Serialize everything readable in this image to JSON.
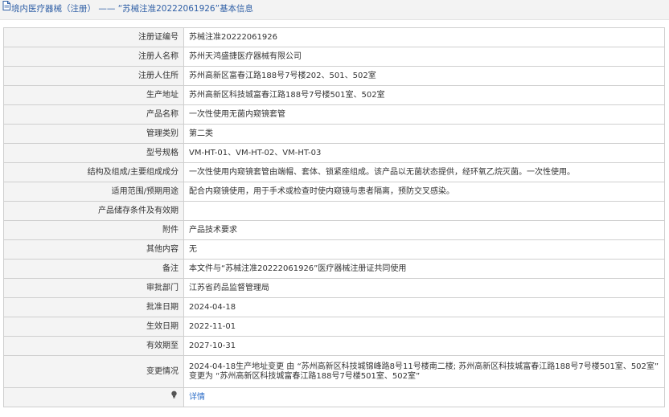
{
  "header": {
    "prefix": "境内医疗器械（注册）",
    "separator": " —— ",
    "quoted_name": "“苏械注准20222061926”",
    "suffix": "基本信息"
  },
  "rows": [
    {
      "label": "注册证编号",
      "value": "苏械注准20222061926"
    },
    {
      "label": "注册人名称",
      "value": "苏州天鸿盛捷医疗器械有限公司"
    },
    {
      "label": "注册人住所",
      "value": "苏州高新区富春江路188号7号楼202、501、502室"
    },
    {
      "label": "生产地址",
      "value": "苏州高新区科技城富春江路188号7号楼501室、502室"
    },
    {
      "label": "产品名称",
      "value": "一次性使用无菌内窥镜套管"
    },
    {
      "label": "管理类别",
      "value": "第二类"
    },
    {
      "label": "型号规格",
      "value": "VM-HT-01、VM-HT-02、VM-HT-03"
    },
    {
      "label": "结构及组成/主要组成成分",
      "value": "一次性使用内窥镜套管由端帽、套体、锁紧座组成。该产品以无菌状态提供，经环氧乙烷灭菌。一次性使用。"
    },
    {
      "label": "适用范围/预期用途",
      "value": "配合内窥镜使用，用于手术或检查时使内窥镜与患者隔离，预防交叉感染。"
    },
    {
      "label": "产品储存条件及有效期",
      "value": ""
    },
    {
      "label": "附件",
      "value": "产品技术要求"
    },
    {
      "label": "其他内容",
      "value": "无"
    },
    {
      "label": "备注",
      "value": "本文件与“苏械注准20222061926”医疗器械注册证共同使用"
    },
    {
      "label": "审批部门",
      "value": "江苏省药品监督管理局"
    },
    {
      "label": "批准日期",
      "value": "2024-04-18"
    },
    {
      "label": "生效日期",
      "value": "2022-11-01"
    },
    {
      "label": "有效期至",
      "value": "2027-10-31"
    }
  ],
  "change": {
    "label": "变更情况",
    "line1": "2024-04-18生产地址变更 由 “苏州高新区科技城锦峰路8号11号楼南二楼; 苏州高新区科技城富春江路188号7号楼501室、502室”",
    "line2": "变更为 “苏州高新区科技城富春江路188号7号楼501室、502室”"
  },
  "footer": {
    "icon": "lightbulb-icon",
    "link_text": "详情"
  },
  "colors": {
    "header_text": "#2f5fa6",
    "label_bg": "#f4f4f4",
    "border": "#cfcfcf",
    "link": "#2f6fc8"
  }
}
